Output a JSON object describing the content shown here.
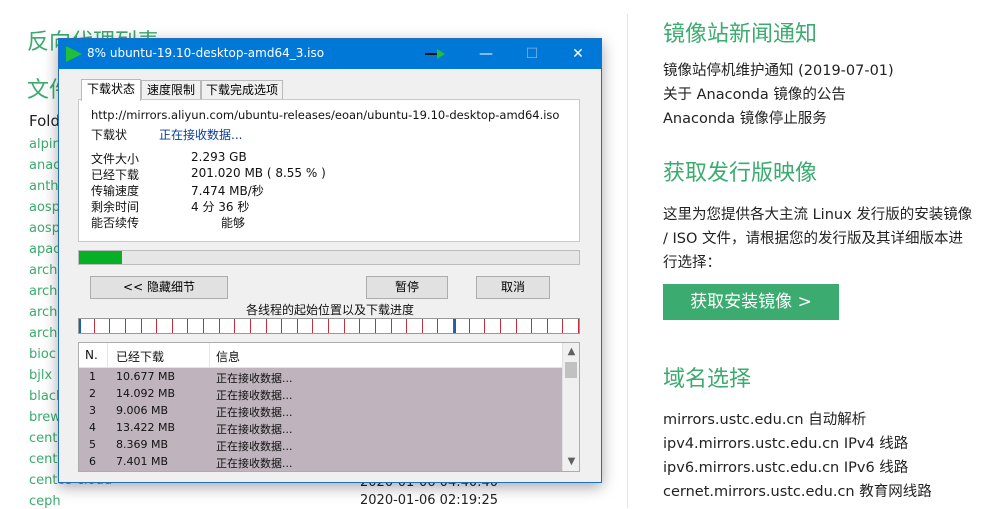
{
  "background": {
    "left_heading_1": "反向代理列表",
    "left_heading_2": "文件",
    "folder_header": "Fold",
    "folder_links": [
      "alpir",
      "anac",
      "anth",
      "aosp",
      "aosp",
      "apac",
      "arch",
      "arch",
      "arch",
      "arch",
      "bioc",
      "bjlx",
      "blacl",
      "brew",
      "cent",
      "cent",
      "centos-cloud",
      "ceph"
    ],
    "folder_dates": [
      "2020-01-06 04:40:40",
      "2020-01-06 02:19:25"
    ],
    "news_title": "镜像站新闻通知",
    "news_items": [
      "镜像站停机维护通知 (2019-07-01)",
      "关于 Anaconda 镜像的公告",
      "Anaconda 镜像停止服务"
    ],
    "distro_title": "获取发行版映像",
    "distro_text": "这里为您提供各大主流 Linux 发行版的安装镜像 / ISO 文件，请根据您的发行版及其详细版本进行选择：",
    "distro_button": "获取安装镜像 >",
    "domain_title": "域名选择",
    "domain_items": [
      "mirrors.ustc.edu.cn 自动解析",
      "ipv4.mirrors.ustc.edu.cn IPv4 线路",
      "ipv6.mirrors.ustc.edu.cn IPv6 线路",
      "cernet.mirrors.ustc.edu.cn 教育网线路"
    ],
    "accent_color": "#3bab6f"
  },
  "dialog": {
    "title": "8% ubuntu-19.10-desktop-amd64_3.iso",
    "minimize_glyph": "—",
    "maximize_glyph": "☐",
    "close_glyph": "✕",
    "tabs": [
      "下载状态",
      "速度限制",
      "下载完成选项"
    ],
    "url": "http://mirrors.aliyun.com/ubuntu-releases/eoan/ubuntu-19.10-desktop-amd64.iso",
    "status_label": "下载状",
    "status_value": "正在接收数据...",
    "details": [
      {
        "label": "文件大小",
        "value": "2.293  GB"
      },
      {
        "label": "已经下载",
        "value": "201.020  MB ( 8.55 % )"
      },
      {
        "label": "传输速度",
        "value": "7.474  MB/秒"
      },
      {
        "label": "剩余时间",
        "value": "4 分 36 秒"
      },
      {
        "label": "能否续传",
        "value": "能够"
      }
    ],
    "progress_fraction": 0.0855,
    "progress_color": "#06b025",
    "hide_details_button": "<< 隐藏细节",
    "pause_button": "暂停",
    "cancel_button": "取消",
    "segments_caption": "各线程的起始位置以及下载进度",
    "thread_segment_count": 32,
    "thread_marker_segment": 24,
    "list_headers": [
      "N.",
      "已经下载",
      "信息"
    ],
    "rows": [
      {
        "n": "1",
        "downloaded": "10.677 MB",
        "info": "正在接收数据..."
      },
      {
        "n": "2",
        "downloaded": "14.092 MB",
        "info": "正在接收数据..."
      },
      {
        "n": "3",
        "downloaded": "9.006 MB",
        "info": "正在接收数据..."
      },
      {
        "n": "4",
        "downloaded": "13.422 MB",
        "info": "正在接收数据..."
      },
      {
        "n": "5",
        "downloaded": "8.369 MB",
        "info": "正在接收数据..."
      },
      {
        "n": "6",
        "downloaded": "7.401 MB",
        "info": "正在接收数据..."
      }
    ]
  }
}
